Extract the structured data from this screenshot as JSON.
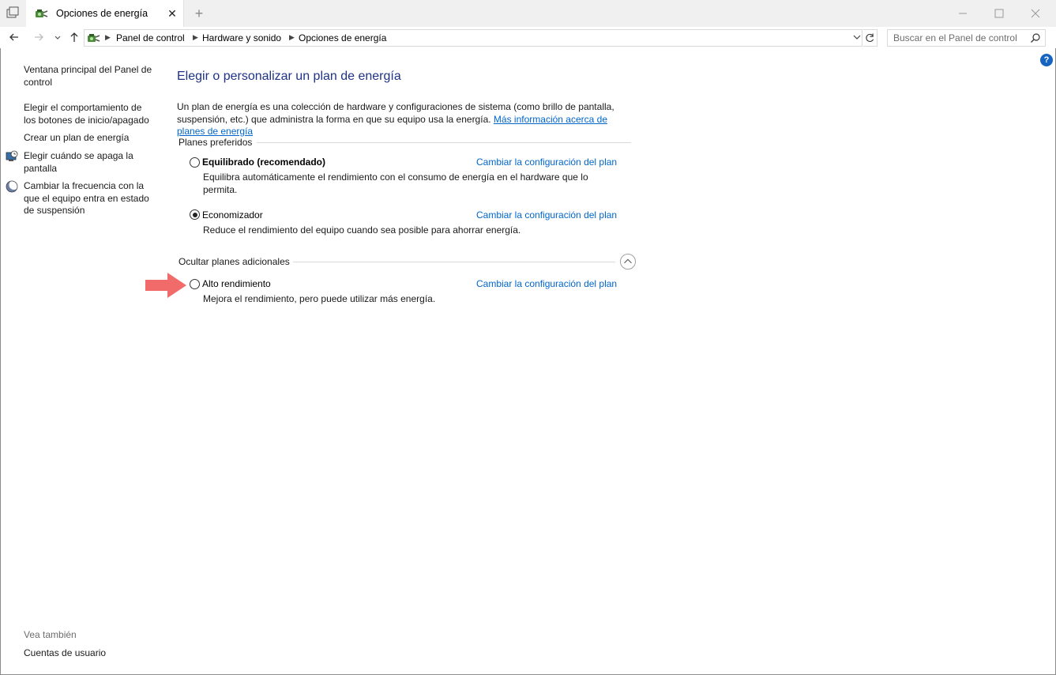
{
  "window": {
    "tab_title": "Opciones de energía",
    "new_tab_symbol": "+",
    "close_tab_symbol": "✕"
  },
  "breadcrumb": [
    "Panel de control",
    "Hardware y sonido",
    "Opciones de energía"
  ],
  "search": {
    "placeholder": "Buscar en el Panel de control"
  },
  "help_symbol": "?",
  "sidebar": {
    "items": [
      {
        "label": "Ventana principal del Panel de control",
        "icon": ""
      },
      {
        "label": "Elegir el comportamiento de los botones de inicio/apagado",
        "icon": ""
      },
      {
        "label": "Crear un plan de energía",
        "icon": ""
      },
      {
        "label": "Elegir cuándo se apaga la pantalla",
        "icon": "monitor-clock-icon"
      },
      {
        "label": "Cambiar la frecuencia con la que el equipo entra en estado de suspensión",
        "icon": "moon-icon"
      }
    ],
    "see_also_title": "Vea también",
    "see_also_items": [
      "Cuentas de usuario"
    ]
  },
  "main": {
    "title": "Elegir o personalizar un plan de energía",
    "description": "Un plan de energía es una colección de hardware y configuraciones de sistema (como brillo de pantalla, suspensión, etc.) que administra la forma en que su equipo usa la energía.",
    "description_link": "Más información acerca de planes de energía",
    "preferred_title": "Planes preferidos",
    "additional_title": "Ocultar planes adicionales",
    "change_link": "Cambiar la configuración del plan",
    "plans": [
      {
        "name": "Equilibrado (recomendado)",
        "description": "Equilibra automáticamente el rendimiento con el consumo de energía en el hardware que lo permita.",
        "selected": false,
        "bold": true
      },
      {
        "name": "Economizador",
        "description": "Reduce el rendimiento del equipo cuando sea posible para ahorrar energía.",
        "selected": true,
        "bold": false
      },
      {
        "name": "Alto rendimiento",
        "description": "Mejora el rendimiento, pero puede utilizar más energía.",
        "selected": false,
        "bold": false
      }
    ]
  },
  "colors": {
    "heading": "#1e3287",
    "link": "#0066cc",
    "arrow": "#f26b6b"
  }
}
